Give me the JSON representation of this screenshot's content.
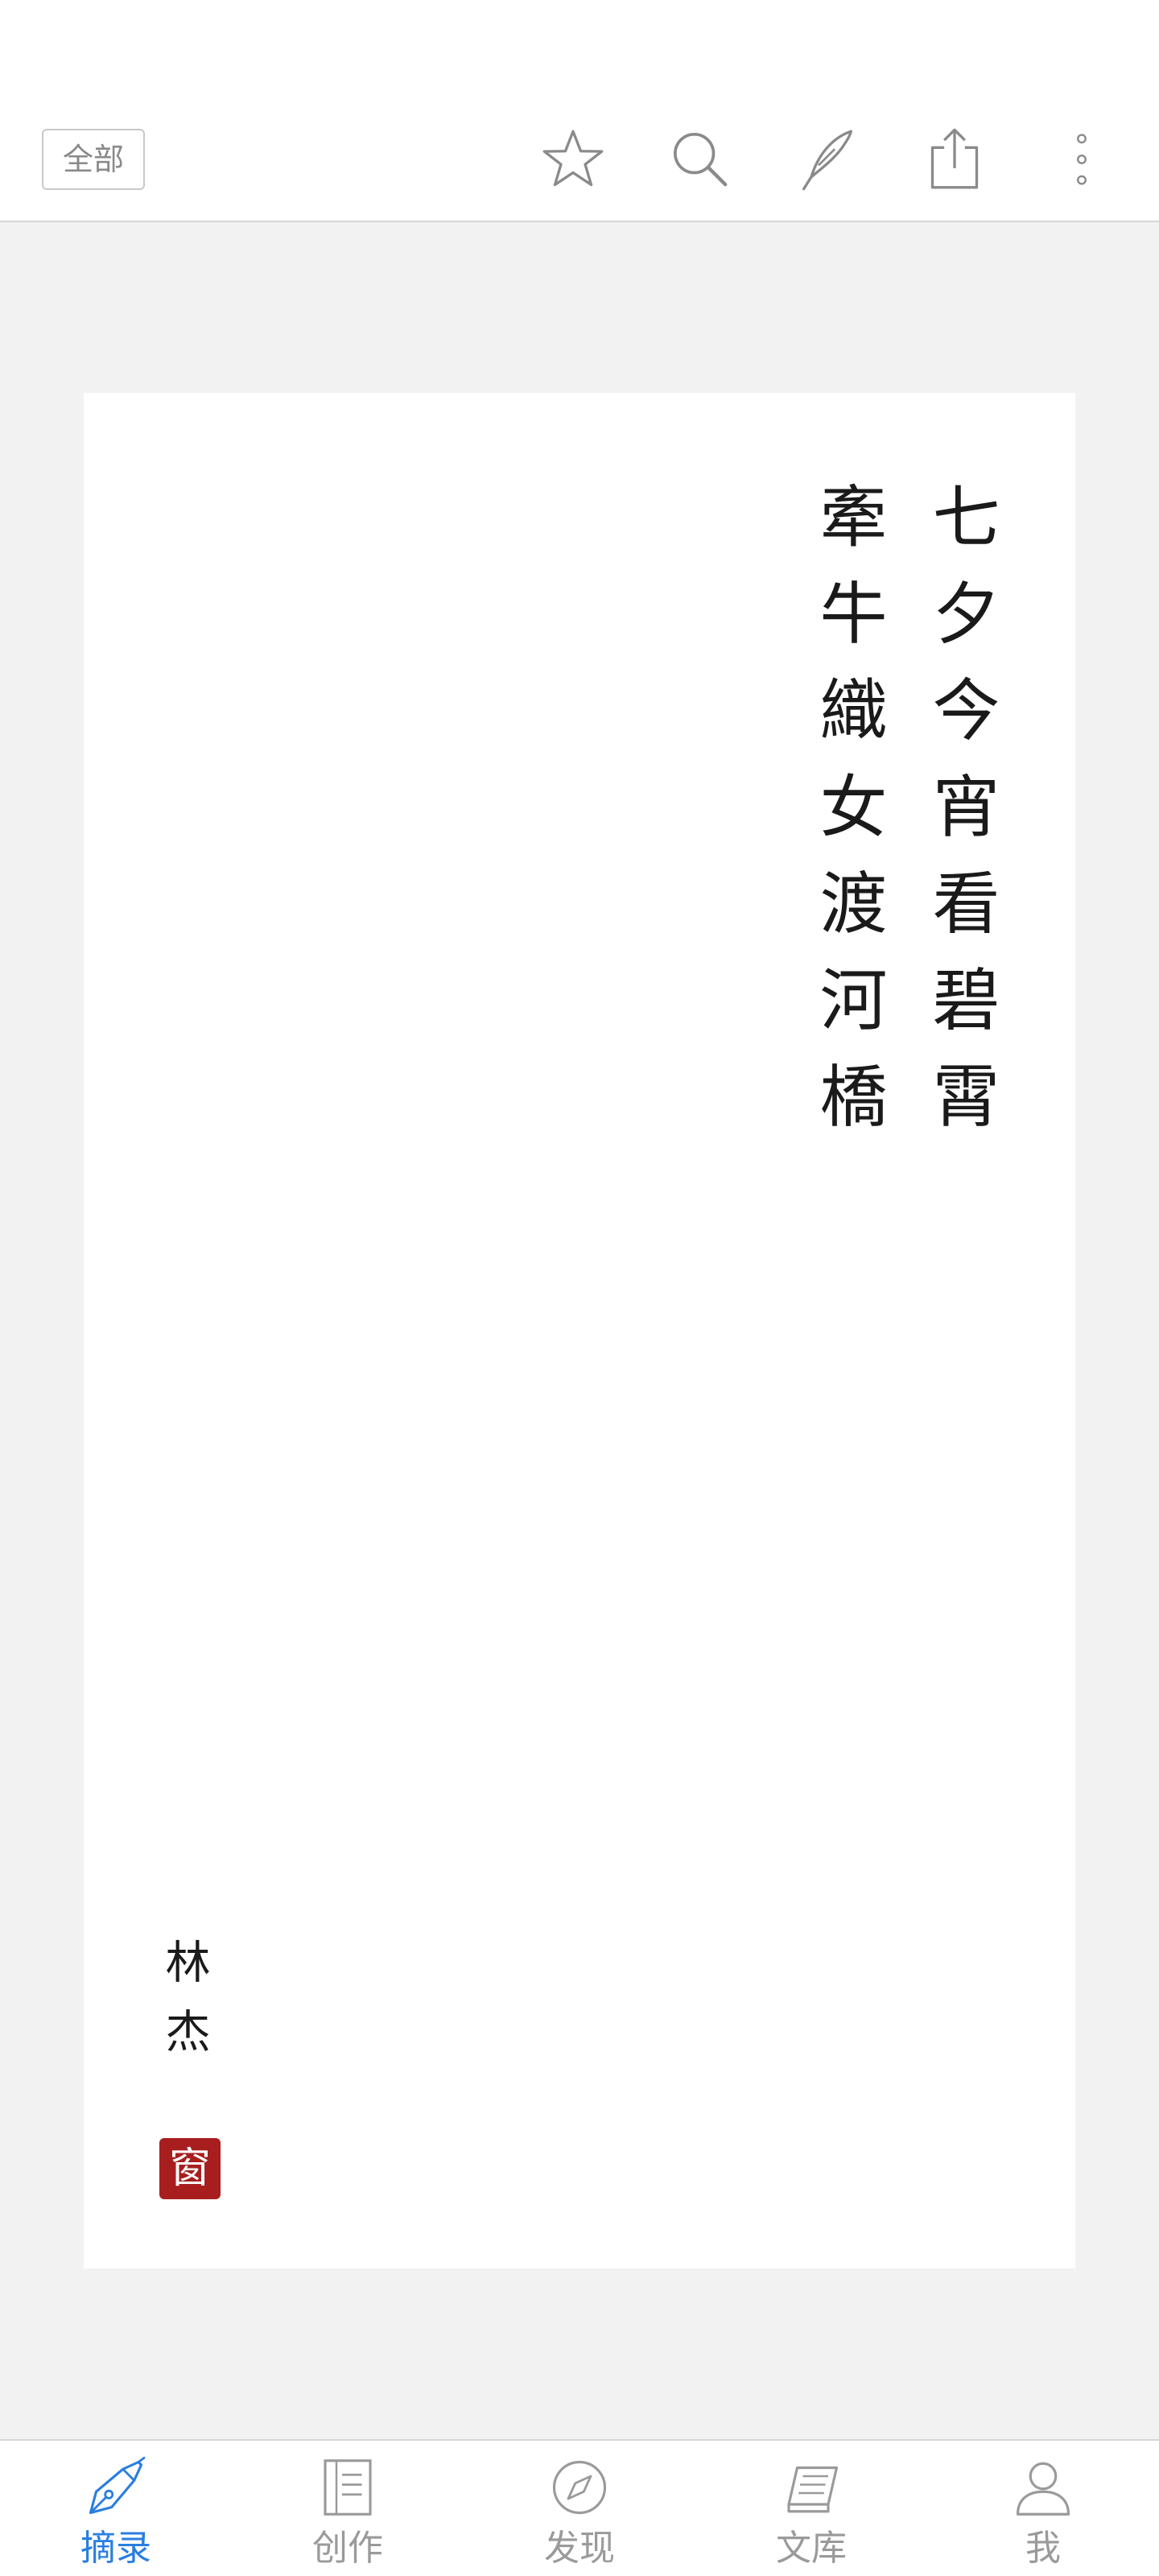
{
  "toolbar": {
    "filter_label": "全部",
    "icons": [
      "star-icon",
      "search-icon",
      "quill-icon",
      "share-icon",
      "more-vertical-icon"
    ]
  },
  "poem": {
    "lines": [
      "七夕今宵看碧霄",
      "牽牛織女渡河橋"
    ],
    "author": "林杰",
    "seal": "窗"
  },
  "nav": {
    "items": [
      {
        "label": "摘录",
        "icon": "pen-nib-icon",
        "active": true
      },
      {
        "label": "创作",
        "icon": "document-icon",
        "active": false
      },
      {
        "label": "发现",
        "icon": "compass-icon",
        "active": false
      },
      {
        "label": "文库",
        "icon": "book-library-icon",
        "active": false
      },
      {
        "label": "我",
        "icon": "user-icon",
        "active": false
      }
    ]
  },
  "colors": {
    "accent": "#2a7ee0",
    "seal": "#a81e1e",
    "icon_gray": "#8a8a8a",
    "background": "#f2f2f2"
  }
}
